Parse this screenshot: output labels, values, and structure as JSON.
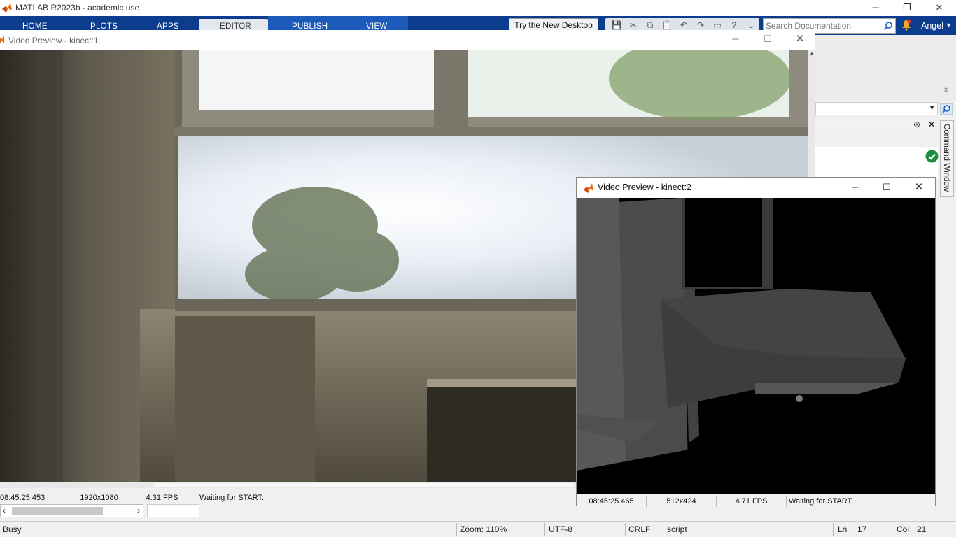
{
  "app": {
    "title": "MATLAB R2023b - academic use",
    "user": "Angel"
  },
  "toolstrip": {
    "tabs": [
      "HOME",
      "PLOTS",
      "APPS",
      "EDITOR",
      "PUBLISH",
      "VIEW"
    ],
    "try_button": "Try the New Desktop",
    "search_placeholder": "Search Documentation"
  },
  "side_panel": {
    "command_window_label": "Command Window"
  },
  "preview1": {
    "title": "Video Preview - kinect:1",
    "timestamp": "08:45:25.453",
    "resolution": "1920x1080",
    "fps": "4.31 FPS",
    "status": "Waiting for START."
  },
  "preview2": {
    "title": "Video Preview - kinect:2",
    "timestamp": "08:45:25.465",
    "resolution": "512x424",
    "fps": "4.71 FPS",
    "status": "Waiting for START."
  },
  "statusbar": {
    "state": "Busy",
    "zoom": "Zoom: 110%",
    "encoding": "UTF-8",
    "line_ending": "CRLF",
    "file_type": "script",
    "ln_label": "Ln",
    "ln_value": "17",
    "col_label": "Col",
    "col_value": "21"
  },
  "colors": {
    "toolstrip": "#0c3c8e",
    "toolstrip_active": "#1d5bbb",
    "notification": "#f5a623",
    "ok_check": "#1e8e3e"
  }
}
